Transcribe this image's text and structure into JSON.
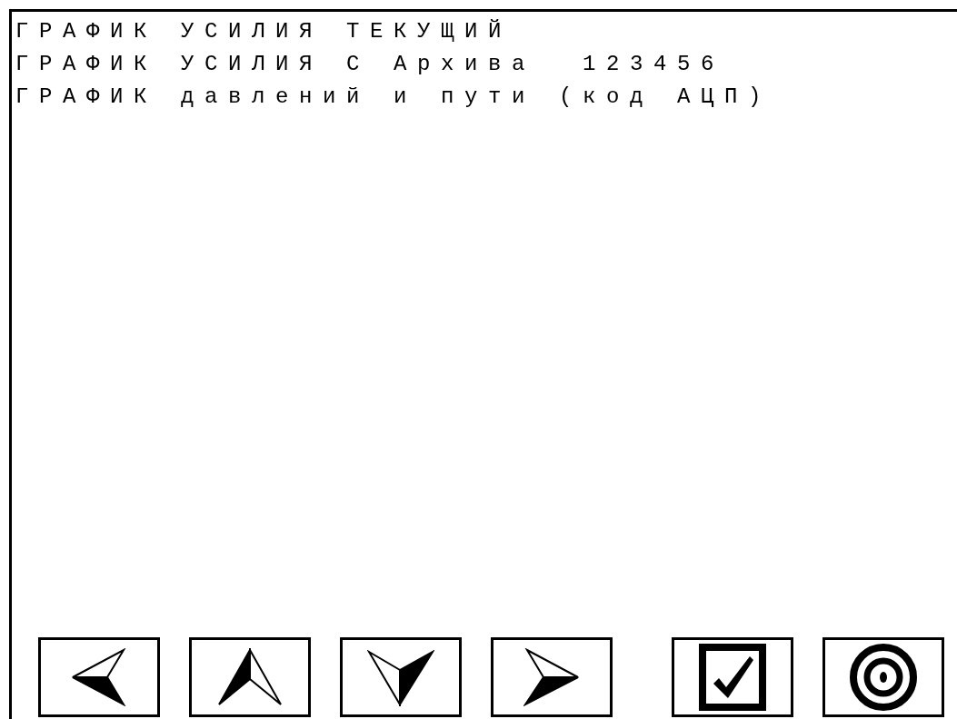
{
  "menu": [
    {
      "label": "ГРАФИК УСИЛИЯ ТЕКУЩИЙ"
    },
    {
      "label": "ГРАФИК УСИЛИЯ С Архива  123456"
    },
    {
      "label": "ГРАФИК давлений и пути (код АЦП)"
    }
  ],
  "buttons": [
    {
      "kind": "left"
    },
    {
      "kind": "up"
    },
    {
      "kind": "down"
    },
    {
      "kind": "right"
    },
    {
      "kind": "confirm"
    },
    {
      "kind": "target"
    }
  ]
}
